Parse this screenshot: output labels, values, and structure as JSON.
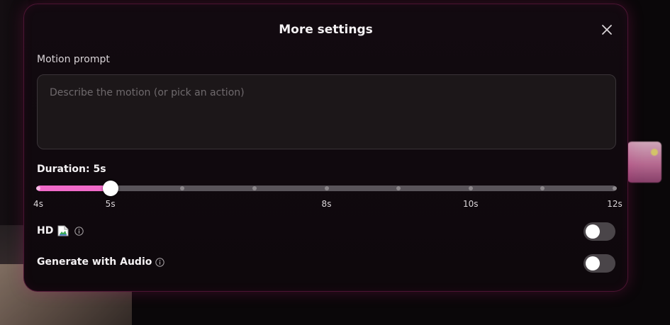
{
  "modal": {
    "title": "More settings",
    "close_icon": "close-icon"
  },
  "motion_prompt": {
    "label": "Motion prompt",
    "value": "",
    "placeholder": "Describe the motion (or pick an action)"
  },
  "duration": {
    "label": "Duration: 5s",
    "min": 4,
    "max": 12,
    "value": 5,
    "steps": [
      4,
      5,
      6,
      7,
      8,
      9,
      10,
      11,
      12
    ],
    "tick_labels": [
      {
        "value": 4,
        "text": "4s"
      },
      {
        "value": 5,
        "text": "5s"
      },
      {
        "value": 8,
        "text": "8s"
      },
      {
        "value": 10,
        "text": "10s"
      },
      {
        "value": 12,
        "text": "12s"
      }
    ],
    "accent_color": "#f06ac8"
  },
  "hd": {
    "label": "HD",
    "image_icon": "broken-image-icon",
    "info_icon": "info-icon",
    "enabled": false
  },
  "audio": {
    "label": "Generate with Audio",
    "info_icon": "info-icon",
    "enabled": false
  }
}
